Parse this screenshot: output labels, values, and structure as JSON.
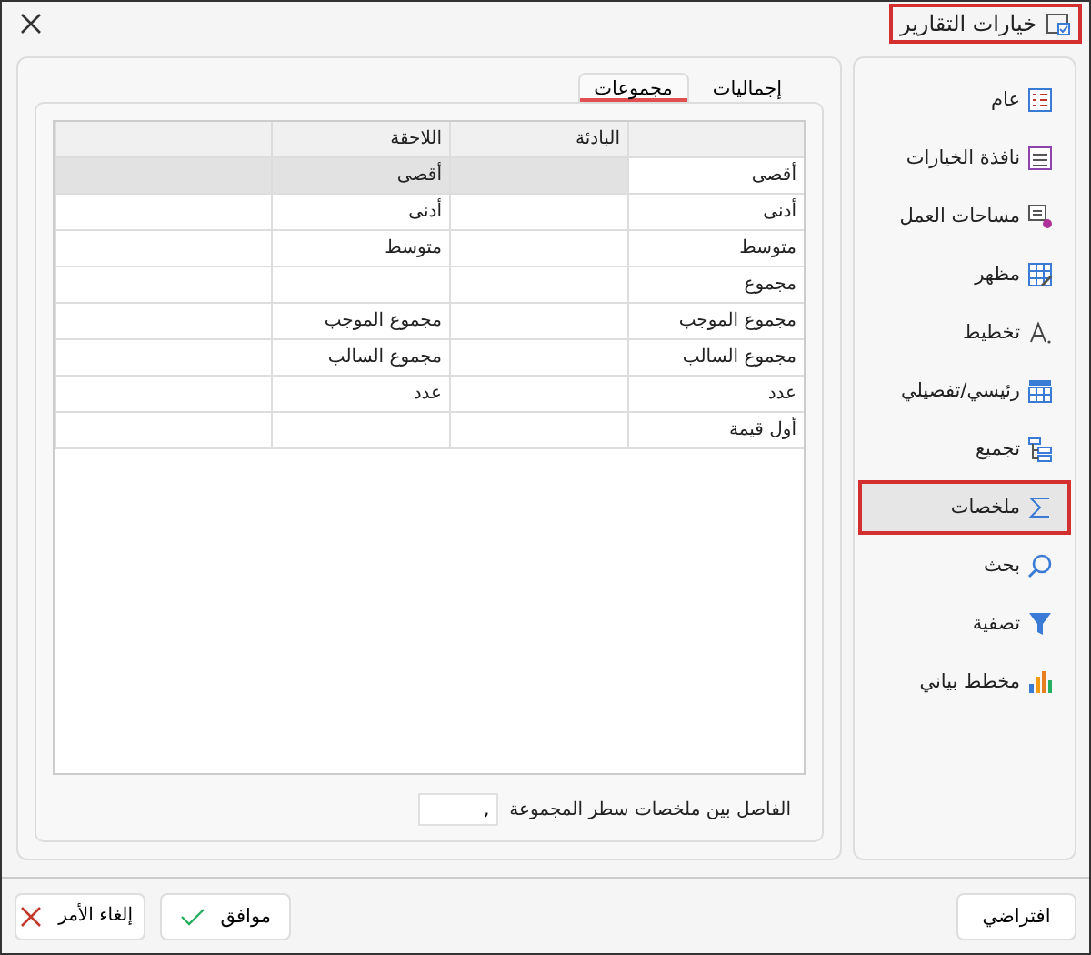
{
  "window": {
    "title": "خيارات التقارير",
    "title_highlighted": true
  },
  "sidebar": {
    "items": [
      {
        "label": "عام",
        "selected": false
      },
      {
        "label": "نافذة الخيارات",
        "selected": false
      },
      {
        "label": "مساحات العمل",
        "selected": false
      },
      {
        "label": "مظهر",
        "selected": false
      },
      {
        "label": "تخطيط",
        "selected": false
      },
      {
        "label": "رئيسي/تفصيلي",
        "selected": false
      },
      {
        "label": "تجميع",
        "selected": false
      },
      {
        "label": "ملخصات",
        "selected": true
      },
      {
        "label": "بحث",
        "selected": false
      },
      {
        "label": "تصفية",
        "selected": false
      },
      {
        "label": "مخطط بياني",
        "selected": false
      }
    ]
  },
  "tabs": [
    {
      "label": "إجماليات",
      "selected": false
    },
    {
      "label": "مجموعات",
      "selected": true
    }
  ],
  "table": {
    "columns": [
      {
        "label": "البادئة"
      },
      {
        "label": "اللاحقة"
      }
    ],
    "rows": [
      {
        "label": "أقصى",
        "suffix": "أقصى",
        "selected": true
      },
      {
        "label": "أدنى",
        "suffix": "أدنى",
        "selected": false
      },
      {
        "label": "متوسط",
        "suffix": "متوسط",
        "selected": false
      },
      {
        "label": "مجموع",
        "selected": false
      },
      {
        "label": "مجموع الموجب",
        "suffix": "مجموع الموجب",
        "selected": false
      },
      {
        "label": "مجموع السالب",
        "suffix": "مجموع السالب",
        "selected": false
      },
      {
        "label": "عدد",
        "suffix": "عدد",
        "selected": false
      },
      {
        "label": "أول قيمة",
        "selected": false
      }
    ]
  },
  "separator_field": {
    "label": "الفاصل بين ملخصات سطر المجموعة",
    "value": ","
  },
  "buttons": {
    "default": "افتراضي",
    "ok": "موافق",
    "cancel": "إلغاء الأمر"
  }
}
